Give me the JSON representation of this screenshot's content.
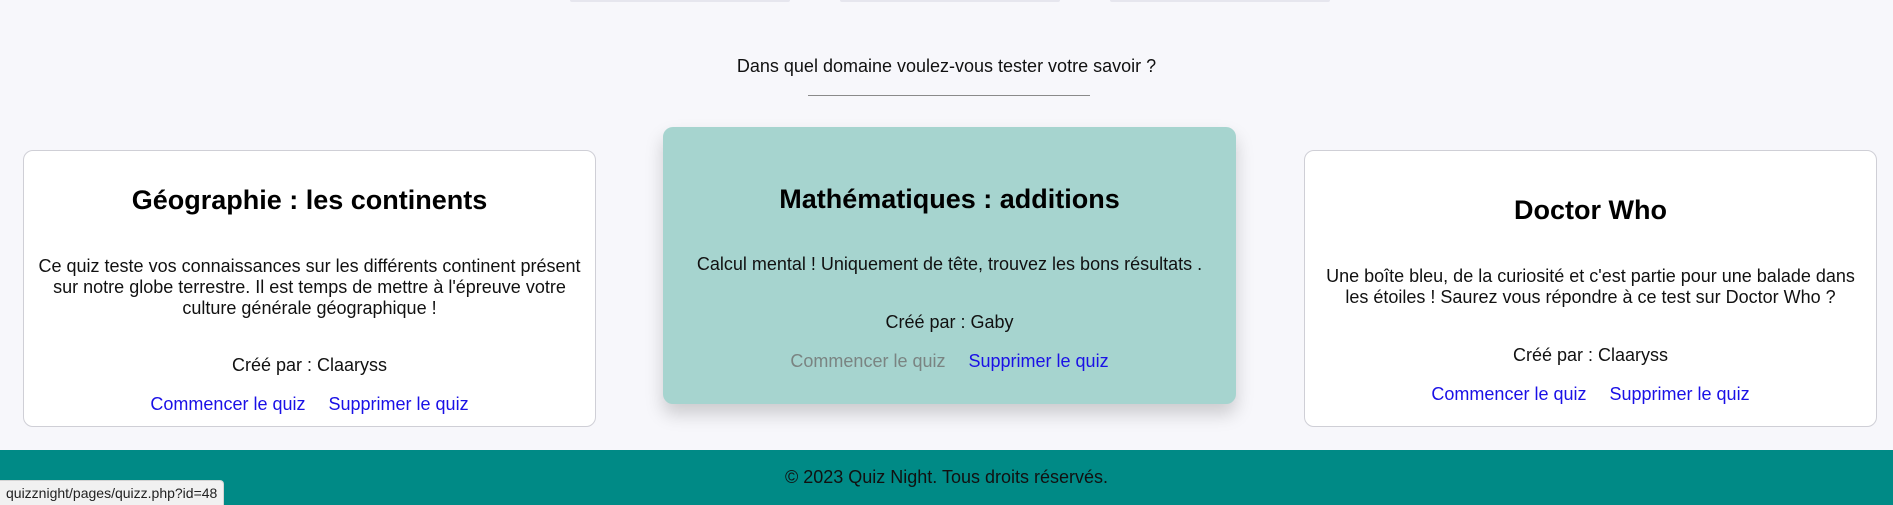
{
  "prompt": "Dans quel domaine voulez-vous tester votre savoir ?",
  "cards": [
    {
      "title": "Géographie : les continents",
      "description": "Ce quiz teste vos connaissances sur les différents continent présent sur notre globe terrestre. Il est temps de mettre à l'épreuve votre culture générale géographique !",
      "author": "Créé par : Claaryss",
      "start_label": "Commencer le quiz",
      "delete_label": "Supprimer le quiz"
    },
    {
      "title": "Mathématiques : additions",
      "description": "Calcul mental ! Uniquement de tête, trouvez les bons résultats .",
      "author": "Créé par : Gaby",
      "start_label": "Commencer le quiz",
      "delete_label": "Supprimer le quiz"
    },
    {
      "title": "Doctor Who",
      "description": "Une boîte bleu, de la curiosité et c'est partie pour une balade dans les étoiles ! Saurez vous répondre à ce test sur Doctor Who ?",
      "author": "Créé par : Claaryss",
      "start_label": "Commencer le quiz",
      "delete_label": "Supprimer le quiz"
    }
  ],
  "footer": {
    "text": "© 2023 Quiz Night. Tous droits réservés."
  },
  "status_bar": {
    "url": "quizznight/pages/quizz.php?id=48"
  },
  "colors": {
    "highlight_card": "#a6d4cf",
    "footer": "#008a86",
    "link": "#1a10e6"
  }
}
